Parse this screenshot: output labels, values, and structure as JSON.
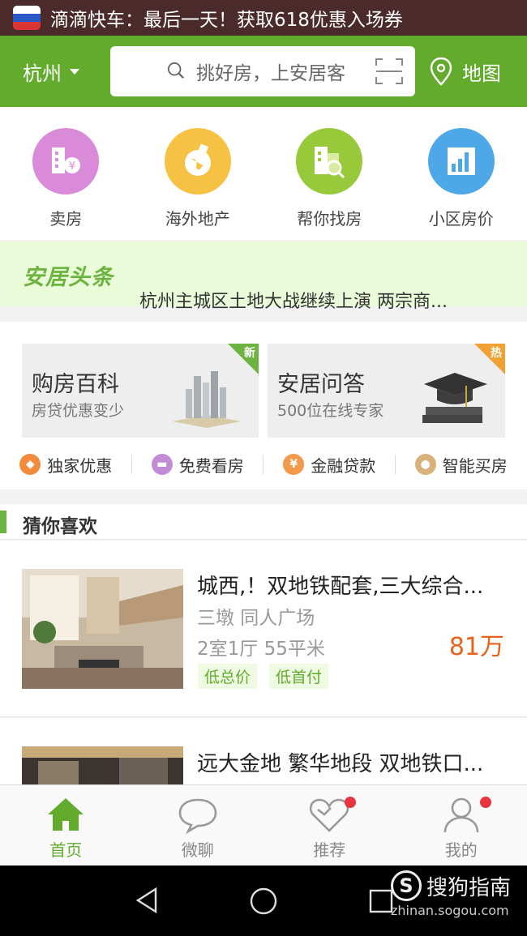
{
  "banner": {
    "text": "滴滴快车：最后一天！获取618优惠入场券"
  },
  "header": {
    "city": "杭州",
    "search_placeholder": "挑好房，上安居客",
    "map_label": "地图",
    "accent": "#62ab2d"
  },
  "categories": [
    {
      "label": "卖房",
      "color": "#d98ad9",
      "icon": "sell-house-icon"
    },
    {
      "label": "海外地产",
      "color": "#f6c244",
      "icon": "globe-icon"
    },
    {
      "label": "帮你找房",
      "color": "#97c93a",
      "icon": "find-house-icon"
    },
    {
      "label": "小区房价",
      "color": "#4ea7e6",
      "icon": "price-chart-icon"
    }
  ],
  "headline": {
    "logo": "安居头条",
    "news": "杭州主城区土地大战继续上演 两宗商..."
  },
  "promo": {
    "left": {
      "title": "购房百科",
      "sub": "房贷优惠变少",
      "badge": "新"
    },
    "right": {
      "title": "安居问答",
      "sub": "500位在线专家",
      "badge": "热"
    },
    "quick": [
      {
        "label": "独家优惠",
        "color": "#f28b3b",
        "icon": "tag-icon"
      },
      {
        "label": "免费看房",
        "color": "#c38cd6",
        "icon": "car-icon"
      },
      {
        "label": "金融贷款",
        "color": "#f2994a",
        "icon": "money-bag-icon"
      },
      {
        "label": "智能买房",
        "color": "#d9b27a",
        "icon": "robot-icon"
      }
    ]
  },
  "guess": {
    "title": "猜你喜欢",
    "listings": [
      {
        "title": "城西,！双地铁配套,三大综合...",
        "location": "三墩 同人广场",
        "spec": "2室1厅  55平米",
        "price": "81万",
        "tags": [
          "低总价",
          "低首付"
        ]
      },
      {
        "title": "远大金地 繁华地段 双地铁口...",
        "location": "",
        "spec": "",
        "price": "",
        "tags": []
      }
    ]
  },
  "tabbar": [
    {
      "label": "首页",
      "active": true,
      "badge": false
    },
    {
      "label": "微聊",
      "active": false,
      "badge": false
    },
    {
      "label": "推荐",
      "active": false,
      "badge": true
    },
    {
      "label": "我的",
      "active": false,
      "badge": true
    }
  ],
  "watermark": {
    "line1": "搜狗指南",
    "line2": "zhinan.sogou.com"
  }
}
